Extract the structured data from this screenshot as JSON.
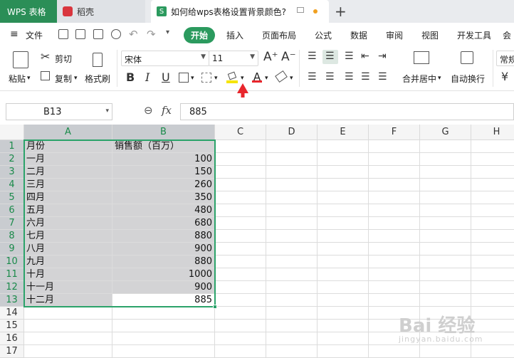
{
  "tabs": {
    "app": "WPS 表格",
    "daoke": "稻壳",
    "doc": "如何给wps表格设置背景颜色?",
    "doc_icon": "S"
  },
  "menu": {
    "file": "文件",
    "items": [
      "开始",
      "插入",
      "页面布局",
      "公式",
      "数据",
      "审阅",
      "视图",
      "开发工具",
      "会"
    ]
  },
  "ribbon": {
    "paste": "粘贴",
    "cut": "剪切",
    "copy": "复制",
    "format_painter": "格式刷",
    "font_name": "宋体",
    "font_size": "11",
    "merge_center": "合并居中",
    "wrap_text": "自动换行",
    "number_format": "常规",
    "currency": "¥"
  },
  "formula_bar": {
    "cell_ref": "B13",
    "fx": "fx",
    "value": "885"
  },
  "columns": [
    "A",
    "B",
    "C",
    "D",
    "E",
    "F",
    "G",
    "H"
  ],
  "rows": [
    "1",
    "2",
    "3",
    "4",
    "5",
    "6",
    "7",
    "8",
    "9",
    "10",
    "11",
    "12",
    "13",
    "14",
    "15",
    "16",
    "17"
  ],
  "sheet": {
    "header": [
      "月份",
      "销售额（百万）"
    ],
    "data": [
      [
        "一月",
        "100"
      ],
      [
        "二月",
        "150"
      ],
      [
        "三月",
        "260"
      ],
      [
        "四月",
        "350"
      ],
      [
        "五月",
        "480"
      ],
      [
        "六月",
        "680"
      ],
      [
        "七月",
        "880"
      ],
      [
        "八月",
        "900"
      ],
      [
        "九月",
        "880"
      ],
      [
        "十月",
        "1000"
      ],
      [
        "十一月",
        "900"
      ],
      [
        "十二月",
        "885"
      ]
    ]
  },
  "watermark": {
    "brand": "Bai 经验",
    "url": "jingyan.baidu.com"
  },
  "colors": {
    "accent": "#2b9a5e",
    "selection": "#2ba36a",
    "fill_gray": "#d3d3d5",
    "arrow": "#e8262c"
  }
}
